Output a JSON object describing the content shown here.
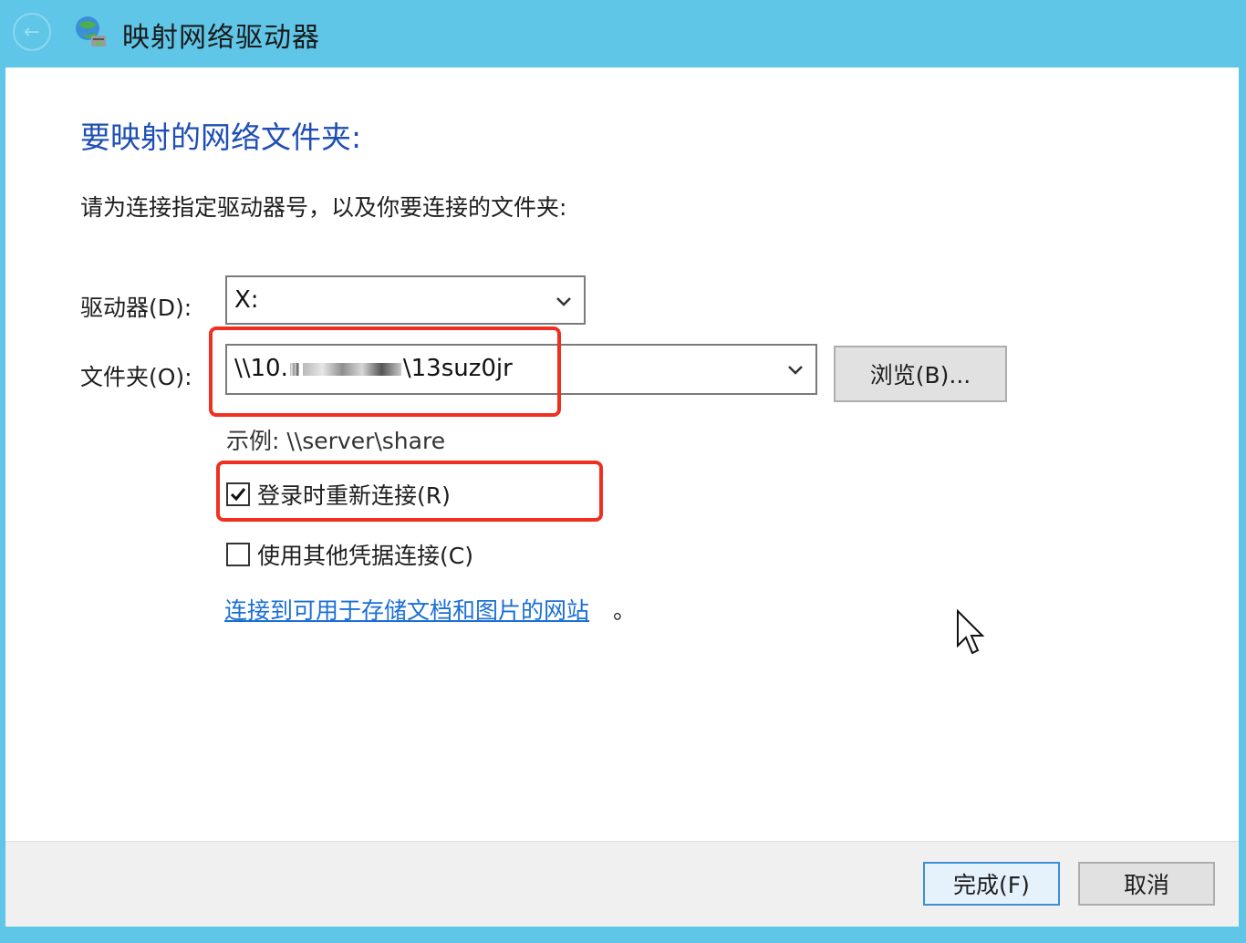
{
  "window": {
    "title": "映射网络驱动器",
    "back_icon": "back-arrow-icon",
    "app_icon": "network-drive-icon"
  },
  "main": {
    "heading": "要映射的网络文件夹:",
    "instruction": "请为连接指定驱动器号，以及你要连接的文件夹:",
    "drive": {
      "label": "驱动器(D):",
      "value": "X:"
    },
    "folder": {
      "label": "文件夹(O):",
      "value_prefix": "\\\\10.",
      "value_suffix": "\\13suz0jr",
      "browse_label": "浏览(B)..."
    },
    "example": "示例: \\\\server\\share",
    "reconnect": {
      "label": "登录时重新连接(R)",
      "checked": true
    },
    "other_credentials": {
      "label": "使用其他凭据连接(C)",
      "checked": false
    },
    "link_text": "连接到可用于存储文档和图片的网站",
    "link_punct": "。"
  },
  "footer": {
    "finish_label": "完成(F)",
    "cancel_label": "取消"
  },
  "colors": {
    "titlebar": "#5fc6e8",
    "heading": "#1f4fb4",
    "link": "#1a6fd4",
    "highlight": "#f0301e"
  }
}
